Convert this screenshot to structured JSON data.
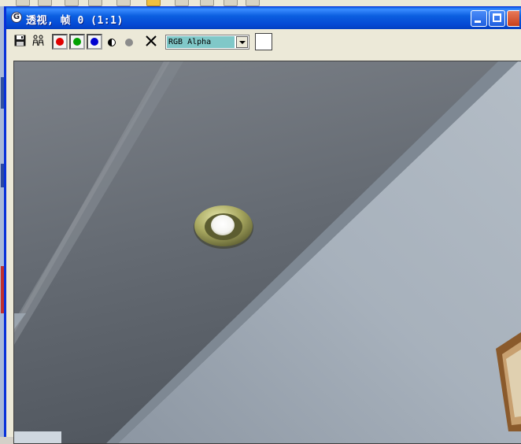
{
  "window": {
    "title": "透视, 帧 0 (1:1)",
    "app_icon": "gmax-logo-icon",
    "controls": [
      "minimize-icon",
      "maximize-icon",
      "close-icon"
    ]
  },
  "toolbar": {
    "items": [
      {
        "name": "save-image-button",
        "icon": "floppy-disk-icon"
      },
      {
        "name": "clone-window-button",
        "icon": "clone-people-icon"
      },
      {
        "name": "red-channel-toggle",
        "icon": "red-dot-icon",
        "color": "#e00000",
        "active": true
      },
      {
        "name": "green-channel-toggle",
        "icon": "green-dot-icon",
        "color": "#00a000",
        "active": true
      },
      {
        "name": "blue-channel-toggle",
        "icon": "blue-dot-icon",
        "color": "#0000d0",
        "active": true
      },
      {
        "name": "monochrome-toggle",
        "icon": "half-circle-icon"
      },
      {
        "name": "alpha-channel-toggle",
        "icon": "gray-dot-icon"
      },
      {
        "name": "clear-button",
        "icon": "x-icon"
      }
    ],
    "channel_select": {
      "value": "RGB Alpha"
    },
    "color_swatch": "#ffffff"
  },
  "colors": {
    "title_bar": "#0b5fe0",
    "window_border": "#0831d9",
    "toolbar_bg": "#ece9d8",
    "ceiling_dark": "#5c636b",
    "wall_light": "#a3adb7",
    "light_fixture_rim": "#a8a860"
  },
  "render": {
    "description_icon": "rendered-scene-ceiling-downlight"
  }
}
